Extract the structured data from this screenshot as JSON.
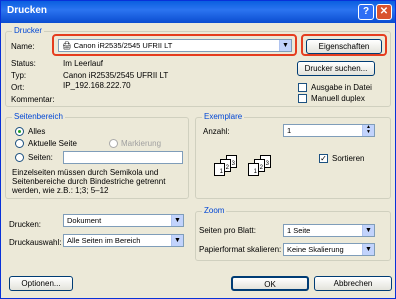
{
  "title": "Drucken",
  "printer_group": {
    "legend": "Drucker",
    "name_label": "Name:",
    "name_value": "Canon iR2535/2545 UFRII LT",
    "properties_button": "Eigenschaften",
    "status_label": "Status:",
    "status_value": "Im Leerlauf",
    "type_label": "Typ:",
    "type_value": "Canon iR2535/2545 UFRII LT",
    "location_label": "Ort:",
    "location_value": "IP_192.168.222.70",
    "comment_label": "Kommentar:",
    "find_printer_button": "Drucker suchen...",
    "print_to_file": "Ausgabe in Datei",
    "manual_duplex": "Manuell duplex"
  },
  "range_group": {
    "legend": "Seitenbereich",
    "all": "Alles",
    "current_page": "Aktuelle Seite",
    "selection": "Markierung",
    "pages": "Seiten:",
    "hint": "Einzelseiten müssen durch Semikola und Seitenbereiche durch Bindestriche getrennt werden, wie z.B.: 1;3; 5–12"
  },
  "copies_group": {
    "legend": "Exemplare",
    "count_label": "Anzahl:",
    "count_value": "1",
    "collate": "Sortieren"
  },
  "print_what_label": "Drucken:",
  "print_what_value": "Dokument",
  "print_label": "Druckauswahl:",
  "print_value": "Alle Seiten im Bereich",
  "zoom_group": {
    "legend": "Zoom",
    "pages_per_sheet_label": "Seiten pro Blatt:",
    "pages_per_sheet_value": "1 Seite",
    "scale_label": "Papierformat skalieren:",
    "scale_value": "Keine Skalierung"
  },
  "options_button": "Optionen...",
  "ok_button": "OK",
  "cancel_button": "Abbrechen",
  "colors": {
    "highlight": "#e53d1f",
    "titlebar": "#0a5fe0"
  }
}
